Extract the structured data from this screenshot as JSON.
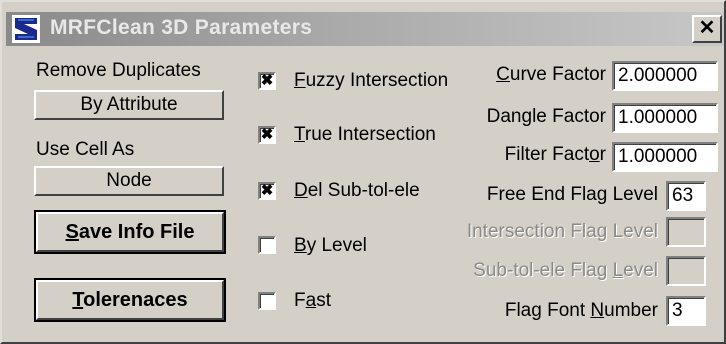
{
  "window": {
    "title": "MRFClean 3D Parameters",
    "close_glyph": "✕"
  },
  "left": {
    "remove_duplicates_label": "Remove Duplicates",
    "remove_duplicates_value": "By Attribute",
    "use_cell_as_label": "Use Cell As",
    "use_cell_as_value": "Node",
    "save_info_file_button": {
      "mnemonic": "S",
      "rest": "ave Info File"
    },
    "tolerances_button": {
      "mnemonic": "T",
      "rest": "olerenaces"
    }
  },
  "checkboxes": [
    {
      "pre": "",
      "mnemonic": "F",
      "post": "uzzy Intersection",
      "checked": true
    },
    {
      "pre": "",
      "mnemonic": "T",
      "post": "rue Intersection",
      "checked": true
    },
    {
      "pre": "",
      "mnemonic": "D",
      "post": "el Sub-tol-ele",
      "checked": true
    },
    {
      "pre": "",
      "mnemonic": "B",
      "post": "y Level",
      "checked": false
    },
    {
      "pre": "F",
      "mnemonic": "a",
      "post": "st",
      "checked": false
    }
  ],
  "check_mark": "✖",
  "right": {
    "curve_factor": {
      "pre": "",
      "mnemonic": "C",
      "post": "urve Factor",
      "value": "2.000000"
    },
    "dangle_factor": {
      "pre": "Dan",
      "mnemonic": "g",
      "post": "le Factor",
      "value": "1.000000"
    },
    "filter_factor": {
      "pre": "Filter Fact",
      "mnemonic": "o",
      "post": "r",
      "value": "1.000000"
    },
    "free_end_flag_level": {
      "label": "Free End Flag Level",
      "value": "63"
    },
    "intersection_flag_level": {
      "label": "Intersection Flag Level",
      "value": ""
    },
    "sub_tol_ele_flag_level": {
      "pre": "Sub-tol-ele Flag ",
      "mnemonic": "L",
      "post": "evel",
      "value": ""
    },
    "flag_font_number": {
      "pre": "Flag Font ",
      "mnemonic": "N",
      "post": "umber",
      "value": "3"
    }
  },
  "icons": {
    "app": "mrfclean-app-icon",
    "close": "close-icon",
    "check": "checkmark-icon"
  }
}
